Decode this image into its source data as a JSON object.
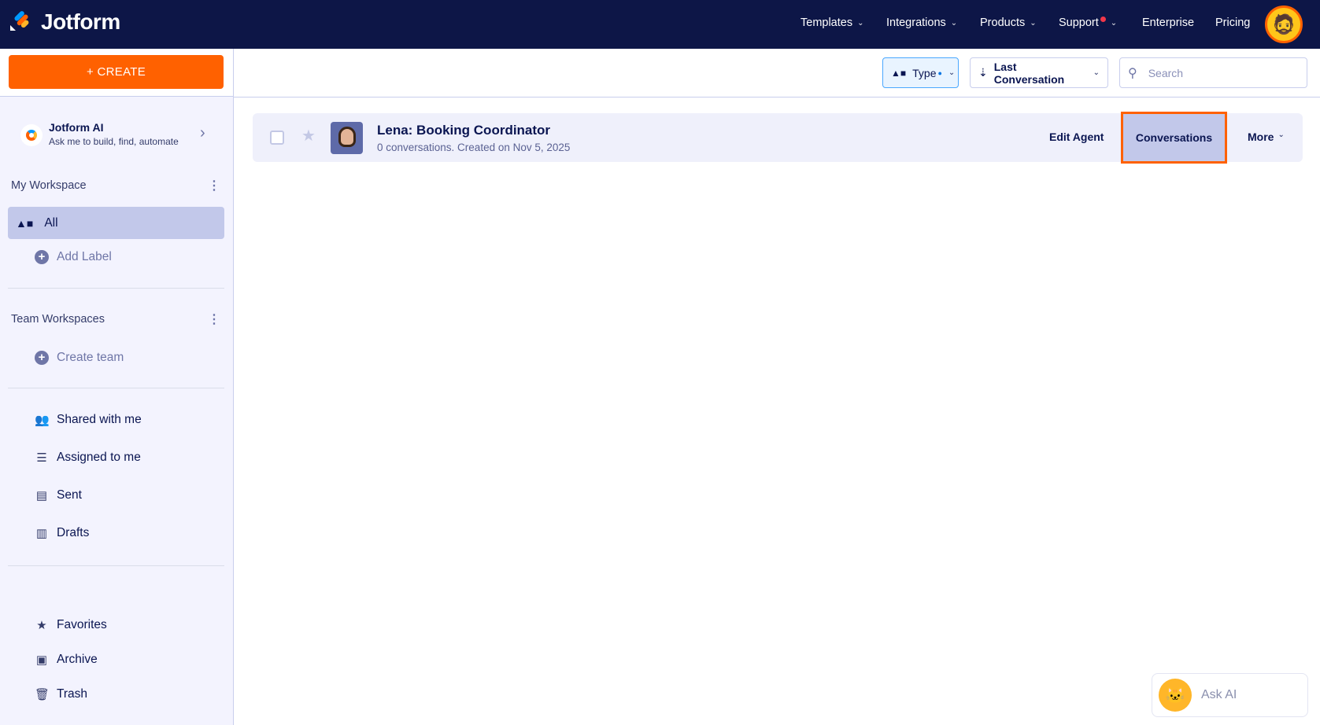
{
  "header": {
    "logo": "Jotform",
    "nav": [
      {
        "label": "Templates"
      },
      {
        "label": "Integrations"
      },
      {
        "label": "Products"
      },
      {
        "label": "Support"
      },
      {
        "label": "Enterprise"
      },
      {
        "label": "Pricing"
      }
    ]
  },
  "sidebar": {
    "create_label": "+ CREATE",
    "ai": {
      "title": "Jotform AI",
      "subtitle": "Ask me to build, find, automate"
    },
    "my_workspace": "My Workspace",
    "all": "All",
    "add_label": "Add Label",
    "team_workspaces": "Team Workspaces",
    "create_team": "Create team",
    "items": [
      {
        "label": "Shared with me"
      },
      {
        "label": "Assigned to me"
      },
      {
        "label": "Sent"
      },
      {
        "label": "Drafts"
      }
    ],
    "bottom": [
      {
        "label": "Favorites"
      },
      {
        "label": "Archive"
      },
      {
        "label": "Trash"
      }
    ]
  },
  "toolbar": {
    "type": "Type",
    "sort": "Last Conversation",
    "search_placeholder": "Search"
  },
  "agents": [
    {
      "title": "Lena: Booking Coordinator",
      "subtitle": "0 conversations. Created on Nov 5, 2025",
      "edit": "Edit Agent",
      "conversations": "Conversations",
      "more": "More"
    }
  ],
  "ask_ai": "Ask AI",
  "colors": {
    "header": "#0d1647",
    "accent": "#ff6100",
    "selected": "#c2c8ea"
  }
}
